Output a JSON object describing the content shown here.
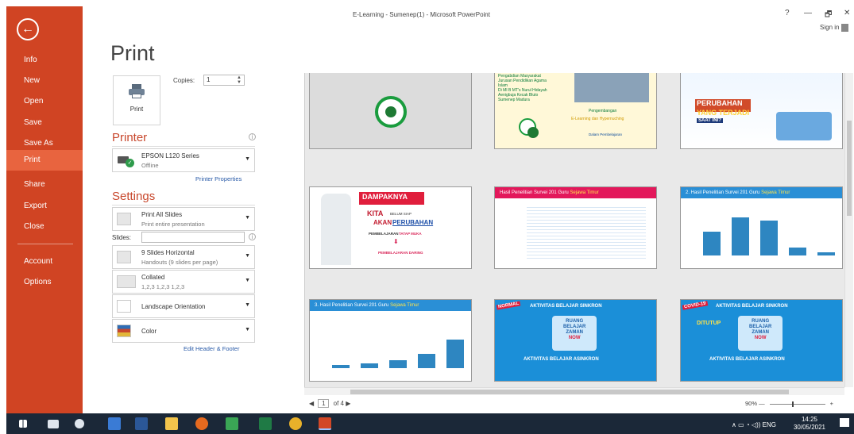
{
  "window": {
    "title": "E-Learning - Sumenep(1) - Microsoft PowerPoint",
    "help": "?",
    "min": "—",
    "restore": "🗗",
    "close": "✕",
    "sign_in": "Sign in"
  },
  "nav": {
    "back_icon": "←",
    "items": [
      {
        "label": "Info"
      },
      {
        "label": "New"
      },
      {
        "label": "Open"
      },
      {
        "label": "Save"
      },
      {
        "label": "Save As"
      },
      {
        "label": "Print"
      },
      {
        "label": "Share"
      },
      {
        "label": "Export"
      },
      {
        "label": "Close"
      },
      {
        "label": "Account"
      },
      {
        "label": "Options"
      }
    ],
    "active": "Print"
  },
  "print": {
    "page_title": "Print",
    "button_label": "Print",
    "copies_label": "Copies:",
    "copies_value": "1"
  },
  "printer": {
    "section": "Printer",
    "name": "EPSON L120 Series",
    "status": "Offline",
    "properties_link": "Printer Properties"
  },
  "settings": {
    "section": "Settings",
    "range": {
      "title": "Print All Slides",
      "sub": "Print entire presentation"
    },
    "slides_label": "Slides:",
    "slides_value": "",
    "layout": {
      "title": "9 Slides Horizontal",
      "sub": "Handouts (9 slides per page)"
    },
    "collate": {
      "title": "Collated",
      "sub": "1,2,3   1,2,3   1,2,3"
    },
    "orientation": "Landscape Orientation",
    "color": "Color",
    "header_footer_link": "Edit Header & Footer"
  },
  "preview": {
    "page_current": "1",
    "page_of": "of 4",
    "zoom": "90%",
    "slides": [
      {
        "texts": []
      },
      {
        "texts": [
          "Pengabdian Masyarakat",
          "Jurusan Pendidikan Agama",
          "Islam",
          "Di MI B MT's Nurul Hidayah",
          "Aenigbuja Kecak Bluto",
          "Sumenep Madura",
          "Pengembangan",
          "E-Learning dan Hypernuching",
          "Dalam Pembelajaran"
        ]
      },
      {
        "texts": [
          "PERUBAHAN",
          "YANG TERJADI",
          "SAAT INI?"
        ]
      },
      {
        "texts": [
          "DAMPAKNYA",
          "KITA",
          "BELUM SIAP",
          "AKAN",
          "PERUBAHAN",
          "PEMBELAJARAN",
          "TATAP MUKA",
          "PEMBELAJARAN DARING"
        ]
      },
      {
        "texts": [
          "Hasil Penelitian Survei 201 Guru",
          "Sejawa Timur"
        ]
      },
      {
        "texts": [
          "2. Hasil Penelitian Survei 201 Guru",
          "Sejawa Timur"
        ]
      },
      {
        "texts": [
          "3. Hasil Penelitian Survei 201 Guru",
          "Sejawa Timur"
        ]
      },
      {
        "texts": [
          "NORMAL",
          "AKTIVITAS BELAJAR SINKRON",
          "RUANG",
          "BELAJAR",
          "ZAMAN",
          "NOW",
          "AKTIVITAS BELAJAR ASINKRON"
        ]
      },
      {
        "texts": [
          "COVID-19",
          "AKTIVITAS BELAJAR SINKRON",
          "DITUTUP",
          "RUANG",
          "BELAJAR",
          "ZAMAN",
          "NOW",
          "AKTIVITAS BELAJAR ASINKRON"
        ]
      }
    ]
  },
  "taskbar": {
    "tray": "ENG",
    "time": "14:25",
    "date": "30/05/2021"
  },
  "colors": {
    "nav_bg": "#d04423",
    "nav_active": "#e8643f",
    "accent": "#c8472c",
    "link": "#2a5ba8",
    "taskbar": "#1b2838"
  }
}
